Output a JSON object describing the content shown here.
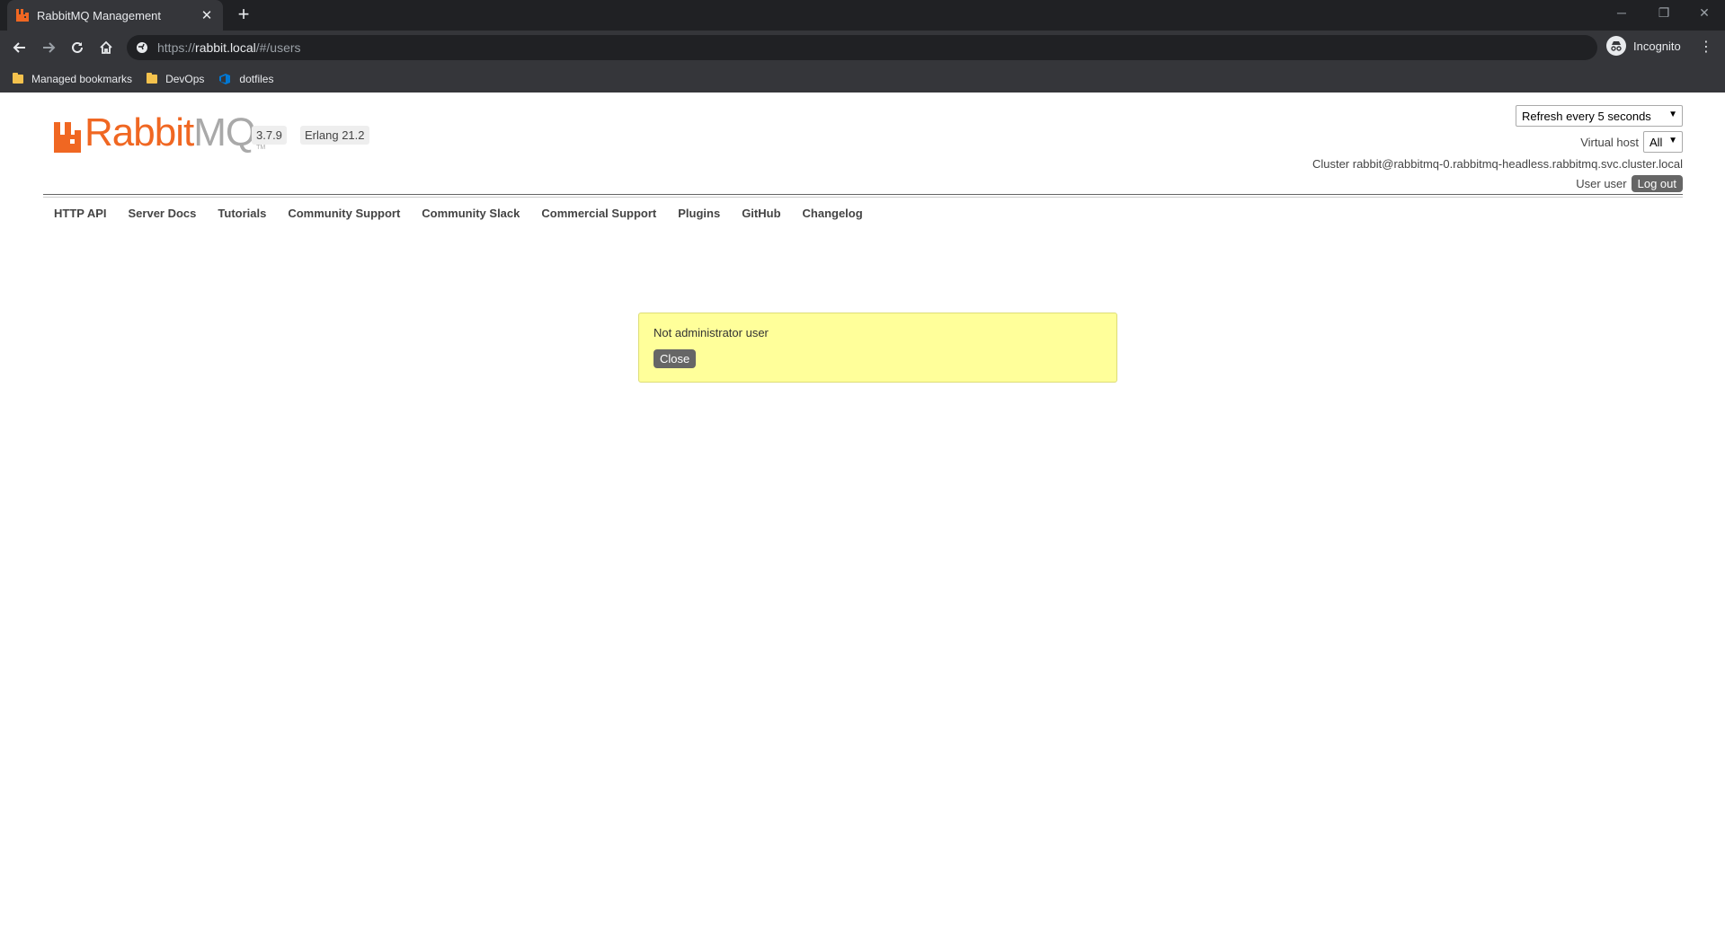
{
  "browser": {
    "tab_title": "RabbitMQ Management",
    "new_tab": "+",
    "url_scheme": "https://",
    "url_host": "rabbit.local",
    "url_path": "/#/users",
    "incognito_label": "Incognito",
    "bookmarks": [
      {
        "label": "Managed bookmarks",
        "icon": "folder-icon"
      },
      {
        "label": "DevOps",
        "icon": "folder-icon"
      },
      {
        "label": "dotfiles",
        "icon": "azure-devops-icon"
      }
    ]
  },
  "header": {
    "logo_rabbit": "Rabbit",
    "logo_mq": "MQ",
    "logo_tm": "TM",
    "version": "3.7.9",
    "erlang": "Erlang 21.2",
    "refresh_selected": "Refresh every 5 seconds",
    "vhost_label": "Virtual host",
    "vhost_selected": "All",
    "cluster_text": "Cluster rabbit@rabbitmq-0.rabbitmq-headless.rabbitmq.svc.cluster.local",
    "user_text": "User user",
    "logout_label": "Log out"
  },
  "nav": {
    "items": [
      "HTTP API",
      "Server Docs",
      "Tutorials",
      "Community Support",
      "Community Slack",
      "Commercial Support",
      "Plugins",
      "GitHub",
      "Changelog"
    ]
  },
  "alert": {
    "message": "Not administrator user",
    "close_label": "Close"
  },
  "colors": {
    "brand_orange": "#f06722",
    "alert_yellow": "#ffff9a",
    "chrome_dark": "#35363a"
  }
}
